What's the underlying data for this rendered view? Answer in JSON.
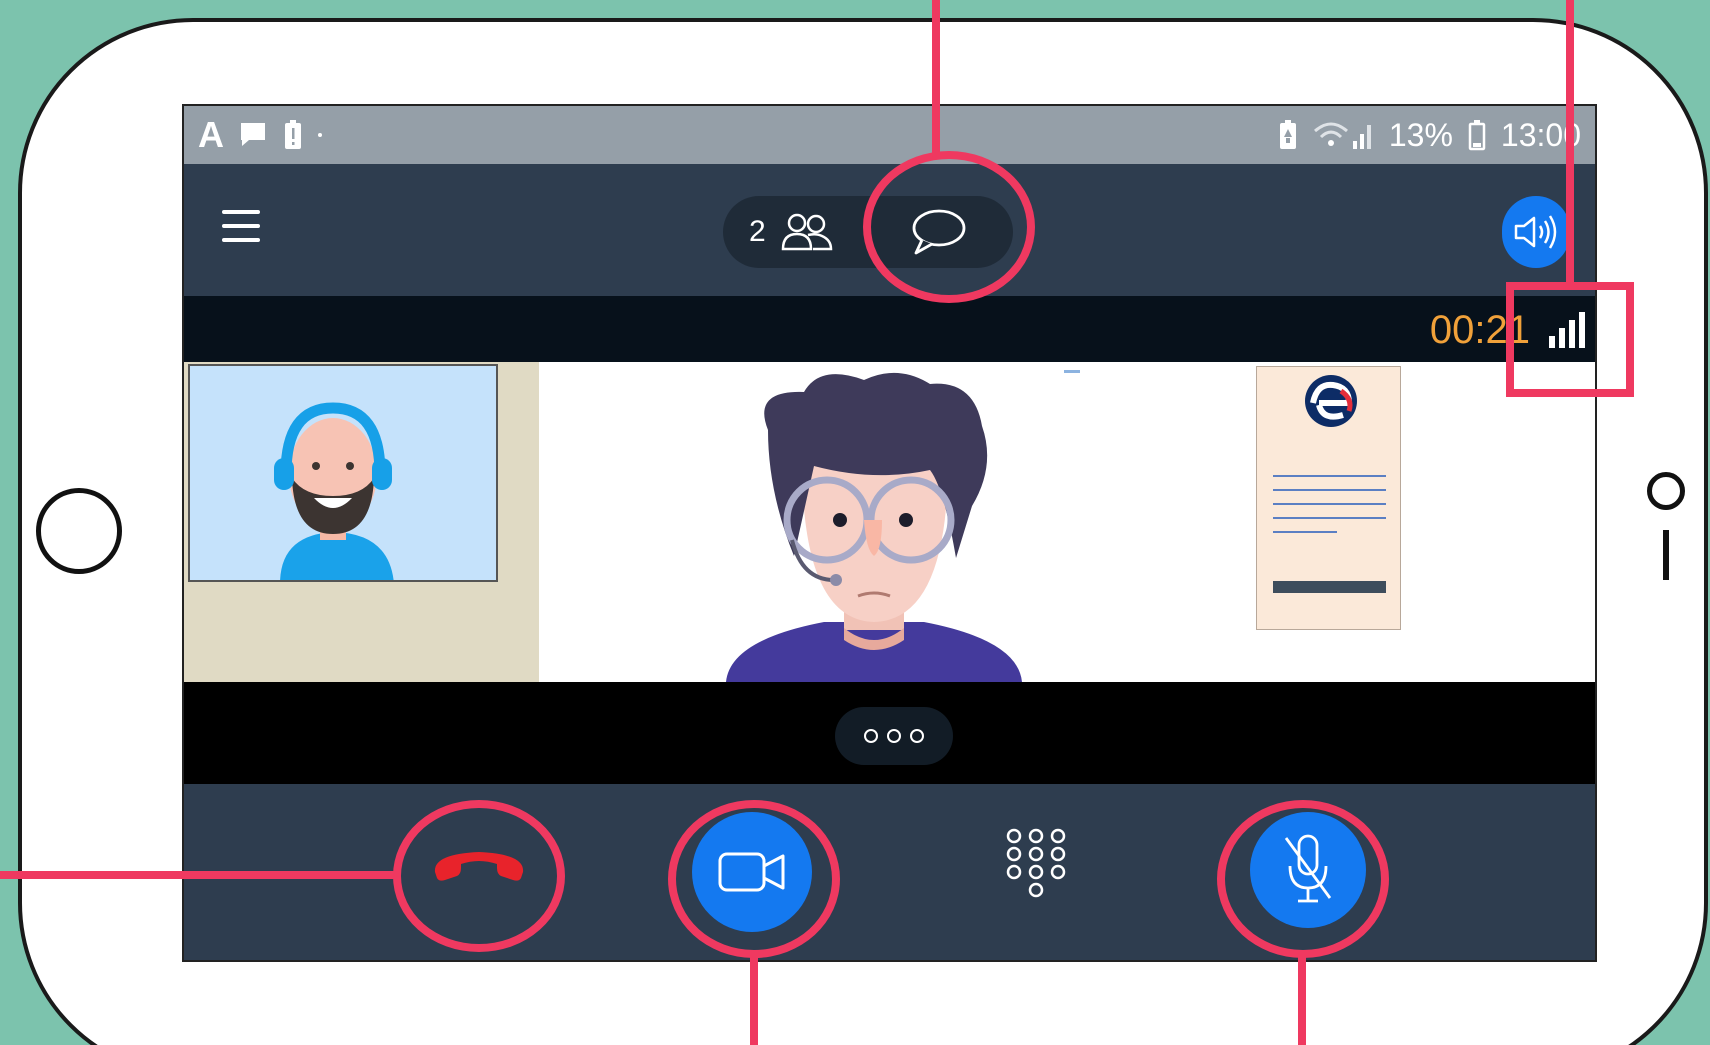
{
  "status_bar": {
    "left_letter": "A",
    "battery_text": "13%",
    "time": "13:00"
  },
  "call_header": {
    "participant_count": "2",
    "icons": [
      "menu-icon",
      "participants-icon",
      "chat-icon",
      "speaker-icon"
    ]
  },
  "call_info": {
    "elapsed_time": "00:21",
    "signal_strength_bars": 4,
    "signal_strength_max": 4
  },
  "controls": {
    "icons": [
      "hangup-icon",
      "camera-icon",
      "keypad-icon",
      "mic-muted-icon"
    ],
    "more_button": "more-options-icon"
  },
  "colors": {
    "accent_blue": "#1479f0",
    "hangup_red": "#e8232b",
    "timer_orange": "#f0a13a",
    "highlight_pink": "#ef3960",
    "toolbar": "#2e3d4f",
    "background": "#7cc3ad"
  }
}
